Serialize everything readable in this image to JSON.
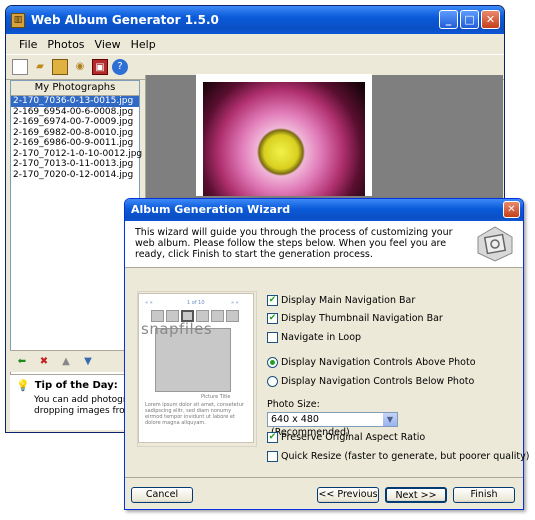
{
  "app": {
    "title": "Web Album Generator 1.5.0",
    "menu": [
      "File",
      "Photos",
      "View",
      "Help"
    ],
    "left_pane_title": "My Photographs",
    "files": [
      "2-170_7036-0-13-0015.jpg",
      "2-169_6954-00-6-0008.jpg",
      "2-169_6974-00-7-0009.jpg",
      "2-169_6982-00-8-0010.jpg",
      "2-169_6986-00-9-0011.jpg",
      "2-170_7012-1-0-10-0012.jpg",
      "2-170_7013-0-11-0013.jpg",
      "2-170_7020-0-12-0014.jpg"
    ],
    "selected_file_index": 0,
    "tip": {
      "title": "Tip of the Day:",
      "line1": "You can add photograp",
      "line2": "dropping images from "
    }
  },
  "wizard": {
    "title": "Album Generation Wizard",
    "intro": "This wizard will guide you through the process of customizing your web album. Please follow the steps below. When you feel you are ready, click Finish to start the generation process.",
    "preview": {
      "nav_left": "« «",
      "nav_center": "1 of 10",
      "nav_right": "» »",
      "caption": "Picture Title",
      "lorem": "Lorem ipsum dolor sit amet, consetetur sadipscing elitr, sed diam nonumy eirmod tempor invidunt ut labore et dolore magna aliquyam.",
      "watermark": "snapfiles"
    },
    "options": {
      "main_nav": {
        "label": "Display Main Navigation Bar",
        "checked": true
      },
      "thumb_nav": {
        "label": "Display Thumbnail Navigation Bar",
        "checked": true
      },
      "loop": {
        "label": "Navigate in Loop",
        "checked": false
      },
      "controls_above": {
        "label": "Display Navigation Controls Above Photo",
        "selected": true
      },
      "controls_below": {
        "label": "Display Navigation Controls Below Photo",
        "selected": false
      },
      "photo_size_label": "Photo Size:",
      "photo_size_value": "640 x 480 (Recommended)",
      "preserve_ratio": {
        "label": "Preserve Original Aspect Ratio",
        "checked": true
      },
      "quick_resize": {
        "label": "Quick Resize (faster to generate, but poorer quality)",
        "checked": false
      }
    },
    "buttons": {
      "cancel": "Cancel",
      "previous": "<< Previous",
      "next": "Next >>",
      "finish": "Finish"
    }
  },
  "check_mark": "✔",
  "colors": {
    "title_blue": "#0a4fc4",
    "selection_blue": "#316ac5",
    "check_green": "#21a121"
  }
}
